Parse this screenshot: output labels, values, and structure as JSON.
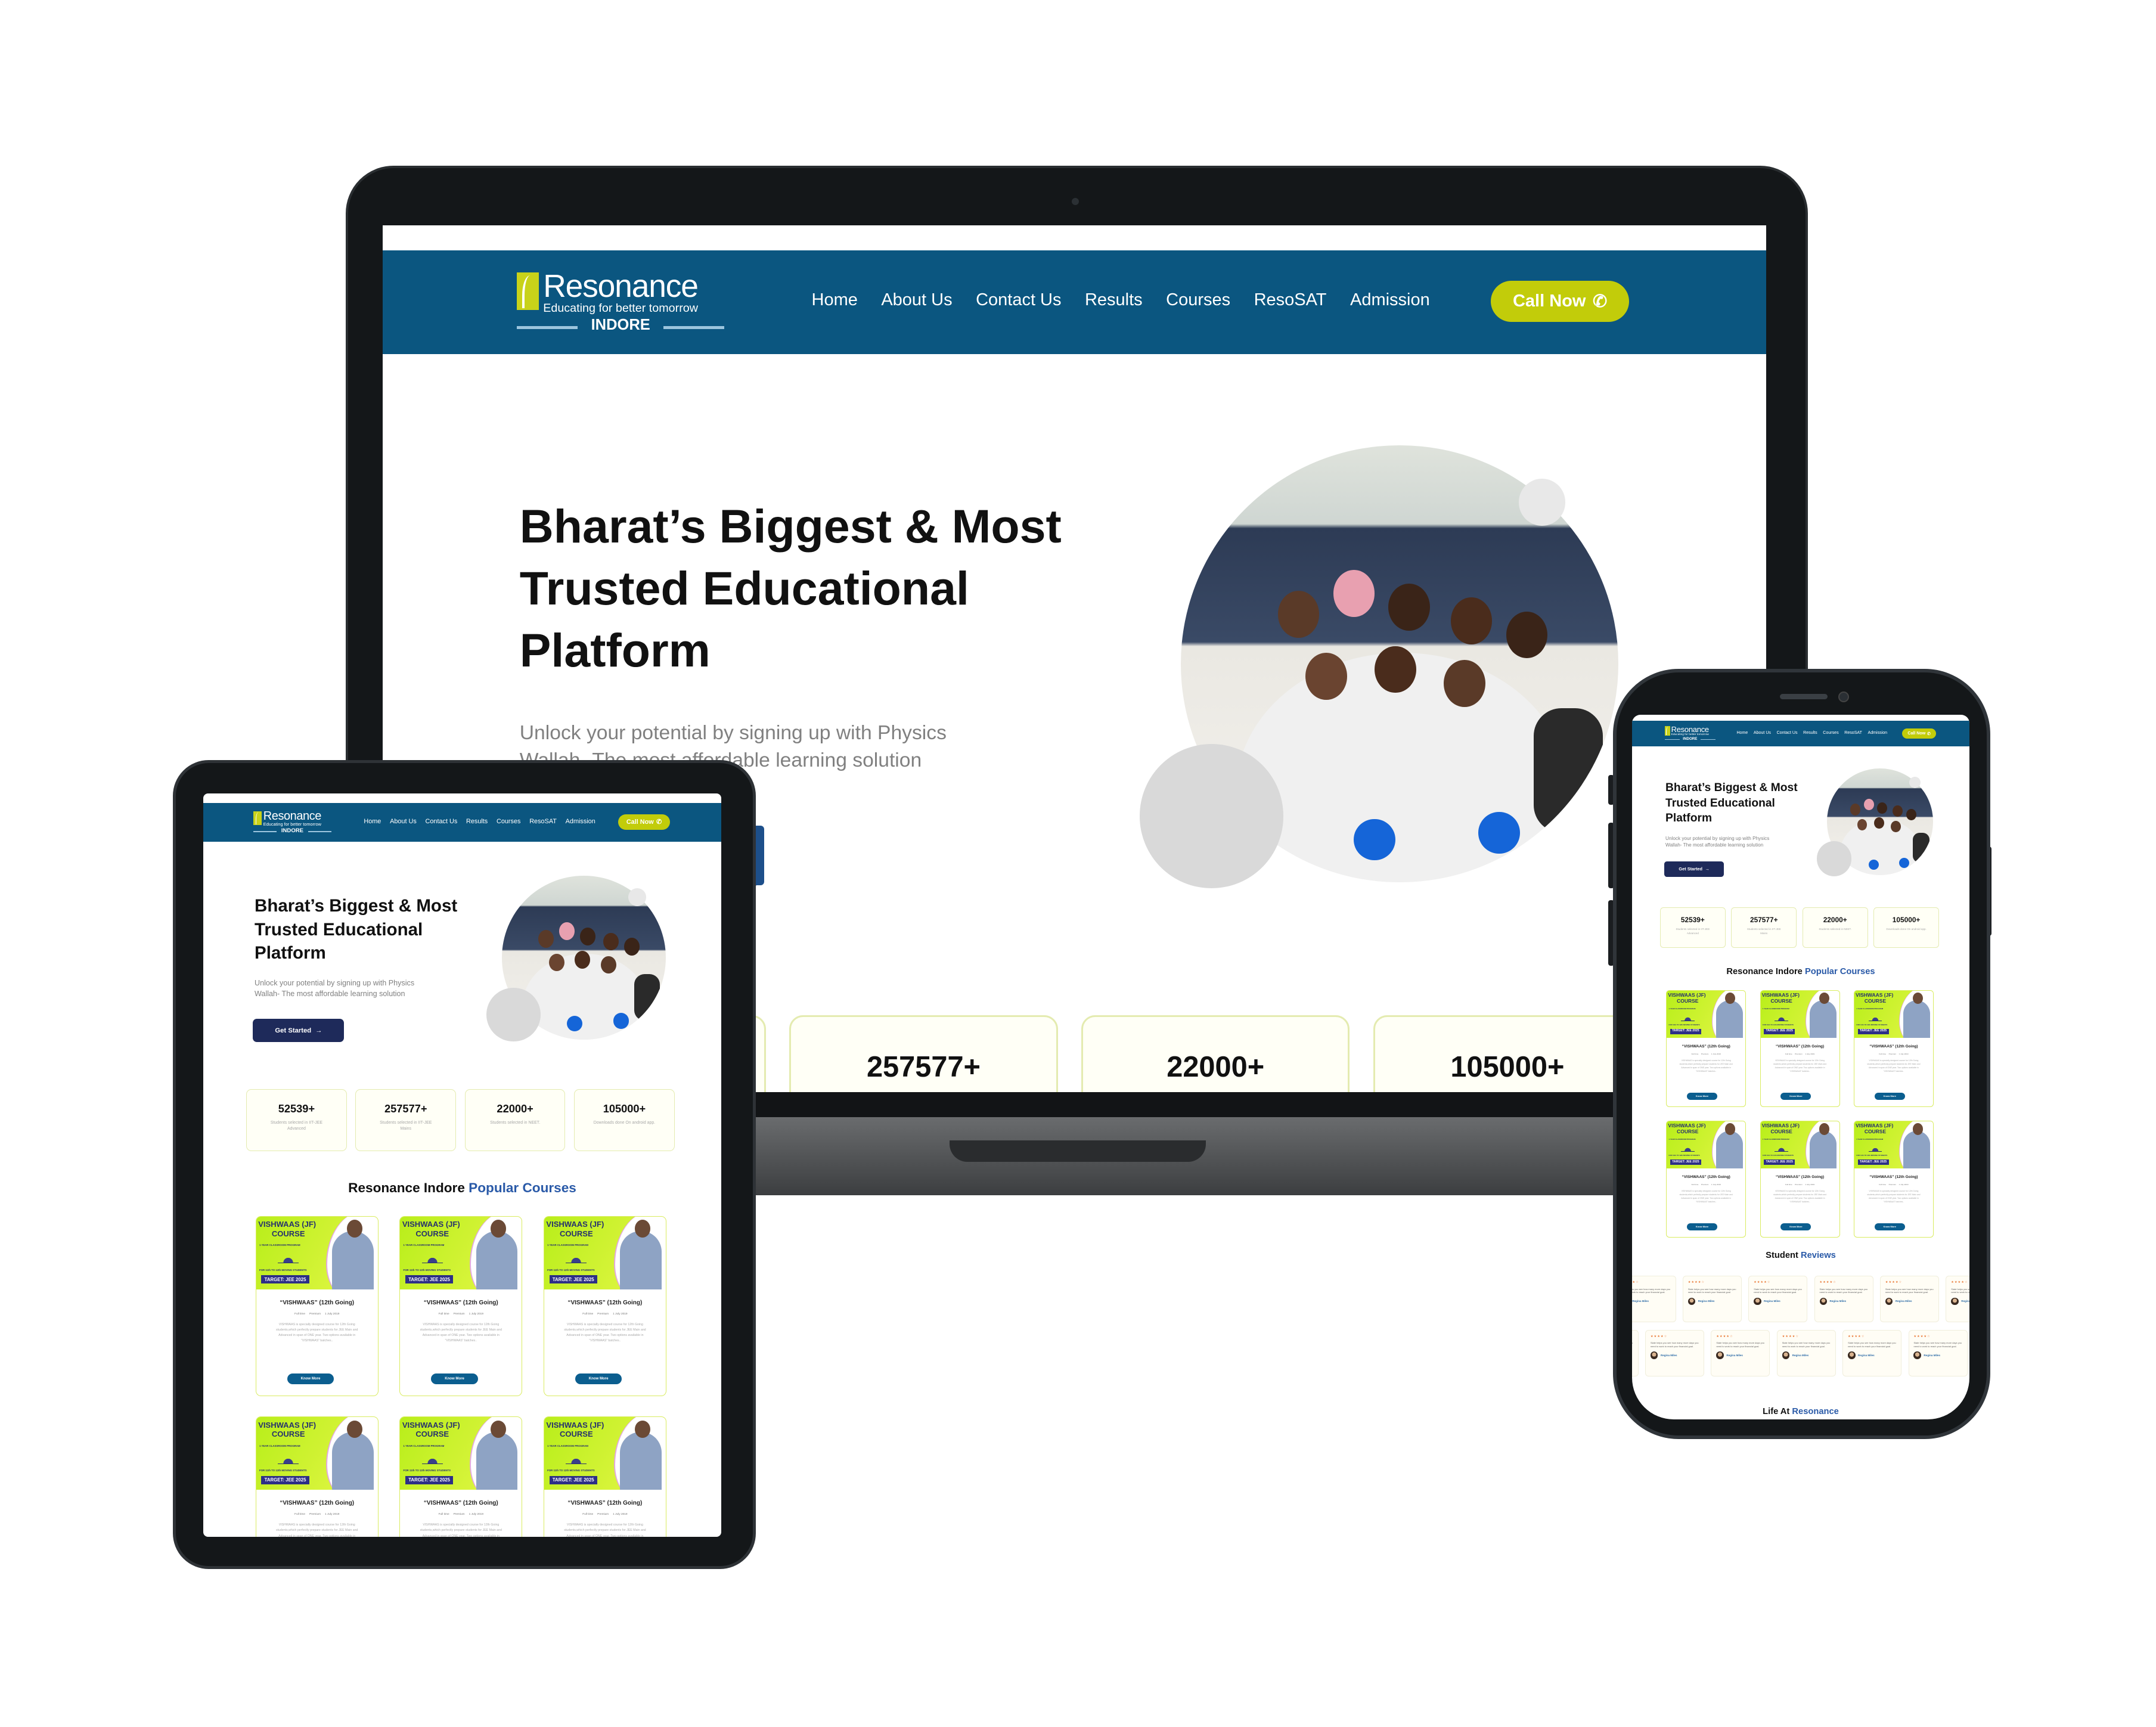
{
  "brand": {
    "logo_name": "Resonance",
    "logo_tagline": "Educating for better tomorrow",
    "logo_city": "INDORE",
    "header_color": "#0b5680",
    "accent_color": "#c2cc0a",
    "highlight_color": "#2a5aa8"
  },
  "nav": {
    "items": [
      "Home",
      "About Us",
      "Contact Us",
      "Results",
      "Courses",
      "ResoSAT",
      "Admission"
    ],
    "call_label": "Call Now",
    "call_icon": "phone-icon"
  },
  "hero": {
    "title": "Bharat’s Biggest & Most Trusted Educational Platform",
    "subtitle": "Unlock your potential by signing up with Physics Wallah- The most affordable learning solution",
    "cta_label": "Get Started",
    "cta_icon": "arrow-right-icon"
  },
  "stats": [
    {
      "value": "52539+",
      "label": "Students selected in IIT-JEE Advanced"
    },
    {
      "value": "257577+",
      "label": "Students selected in IIT-JEE Mains"
    },
    {
      "value": "22000+",
      "label": "Students selected in NEET."
    },
    {
      "value": "105000+",
      "label": "Downloads done On android app."
    }
  ],
  "courses_section": {
    "title_plain": "Resonance Indore ",
    "title_highlight": "Popular Courses"
  },
  "course_card": {
    "banner_line1": "VISHWAAS (JF)",
    "banner_line2": "COURSE",
    "banner_program": "1 YEAR CLASSROOM PROGRAM",
    "banner_for": "FOR 11th TO 12th MOVING STUDENTS",
    "banner_target": "TARGET: JEE 2025",
    "title": "“VISHWAAS” (12th Going)",
    "meta": [
      "Full time",
      "Premium",
      "1 July 2019"
    ],
    "description": "VISHWAAS is specially designed course for 12th Going students,which perfectly prepare students for JEE Main and Advanced in span of ONE year. Two options available in “VISHWAAS” batches..",
    "button_label": "Know More"
  },
  "courses_count_visible": 6,
  "reviews_section": {
    "title_plain": "Student ",
    "title_highlight": "Reviews"
  },
  "review_card": {
    "rating": 4,
    "max_rating": 5,
    "text": "Slate helps you see how many more days you need to work to reach your financial goal.",
    "name": "Regina Miles"
  },
  "life_section": {
    "title_plain": "Life At ",
    "title_highlight": "Resonance"
  }
}
